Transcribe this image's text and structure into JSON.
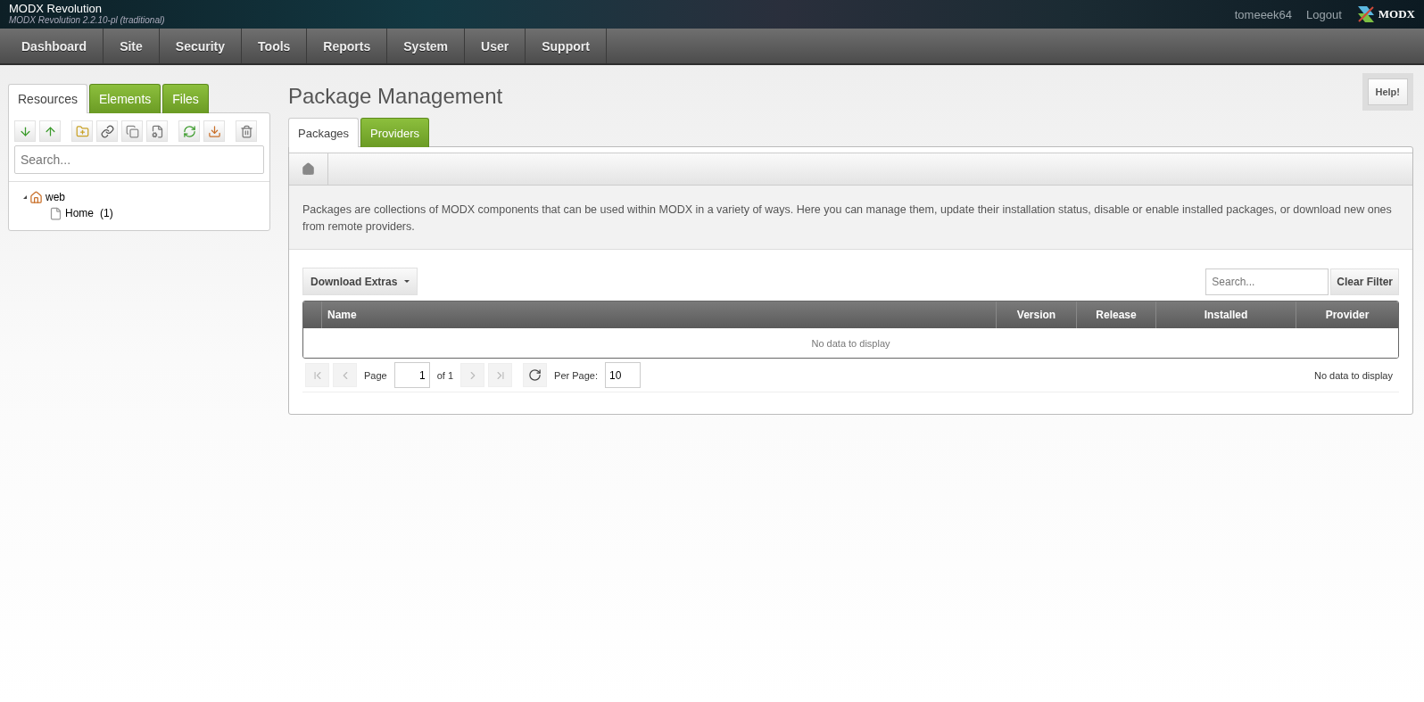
{
  "header": {
    "title": "MODX Revolution",
    "subtitle": "MODX Revolution 2.2.10-pl (traditional)",
    "user": "tomeeek64",
    "logout": "Logout",
    "logo_text": "MODX"
  },
  "nav": [
    "Dashboard",
    "Site",
    "Security",
    "Tools",
    "Reports",
    "System",
    "User",
    "Support"
  ],
  "sidebar": {
    "tabs": [
      {
        "label": "Resources",
        "selected": true
      },
      {
        "label": "Elements",
        "selected": false
      },
      {
        "label": "Files",
        "selected": false
      }
    ],
    "search": {
      "placeholder": "Search..."
    },
    "tree": [
      {
        "label": "web",
        "kind": "context",
        "expanded": true,
        "children": [
          {
            "label": "Home",
            "count": "(1)",
            "kind": "page"
          }
        ]
      }
    ]
  },
  "page": {
    "title": "Package Management",
    "help": "Help!",
    "tabs": [
      {
        "label": "Packages",
        "selected": true
      },
      {
        "label": "Providers",
        "selected": false
      }
    ],
    "description": "Packages are collections of MODX components that can be used within MODX in a variety of ways. Here you can manage them, update their installation status, disable or enable installed packages, or download new ones from remote providers.",
    "download_button": "Download Extras",
    "search": {
      "placeholder": "Search..."
    },
    "clear_filter": "Clear Filter",
    "table": {
      "columns": [
        "Name",
        "Version",
        "Release",
        "Installed",
        "Provider"
      ],
      "empty": "No data to display"
    },
    "pager": {
      "page_label": "Page",
      "page": "1",
      "of": "of 1",
      "per_page_label": "Per Page:",
      "per_page": "10",
      "status": "No data to display"
    }
  }
}
